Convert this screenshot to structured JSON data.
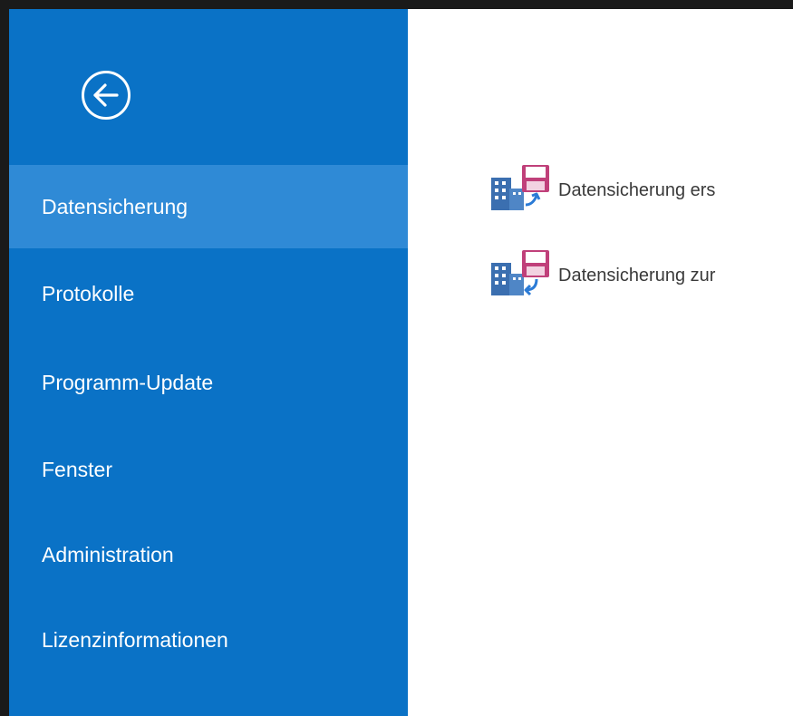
{
  "sidebar": {
    "back_icon": "back-arrow-circle-icon",
    "items": [
      {
        "label": "Datensicherung",
        "selected": true
      },
      {
        "label": "Protokolle",
        "selected": false
      },
      {
        "label": "Programm-Update",
        "selected": false
      },
      {
        "label": "Fenster",
        "selected": false
      },
      {
        "label": "Administration",
        "selected": false
      },
      {
        "label": "Lizenzinformationen",
        "selected": false
      }
    ]
  },
  "main": {
    "actions": [
      {
        "label": "Datensicherung ers",
        "icon": "backup-create-icon"
      },
      {
        "label": "Datensicherung zur",
        "icon": "backup-restore-icon"
      }
    ]
  },
  "colors": {
    "sidebar_bg": "#0a72c6",
    "selected_bg": "#2f8ad6",
    "text_light": "#ffffff",
    "icon_building": "#3b6fb0",
    "icon_disk": "#c0407a"
  }
}
